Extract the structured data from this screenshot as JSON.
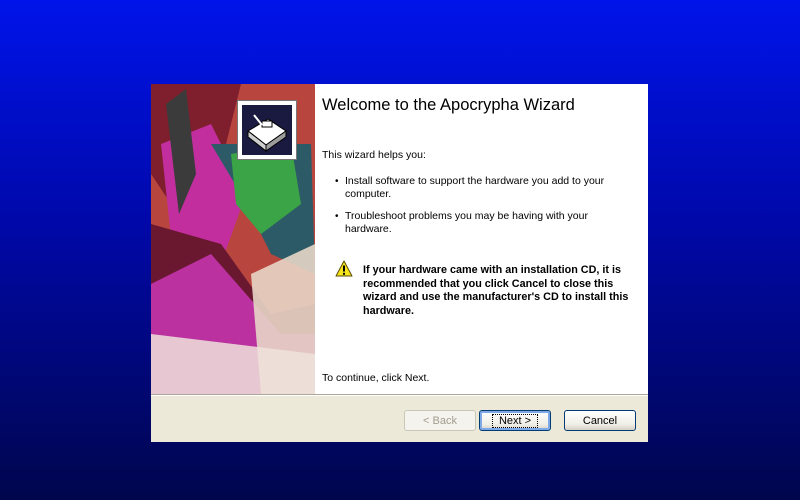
{
  "wizard": {
    "title": "Welcome to the Apocrypha Wizard",
    "intro": "This wizard helps you:",
    "bullets": [
      "Install software to support the hardware you add to your computer.",
      "Troubleshoot problems you may be having with your hardware."
    ],
    "warning": "If your hardware came with an installation CD, it is recommended that you click Cancel to close this wizard and use the manufacturer's CD to install this hardware.",
    "continue_text": "To continue, click Next.",
    "buttons": {
      "back": "< Back",
      "next": "Next >",
      "cancel": "Cancel"
    }
  },
  "icons": {
    "banner_logo": "hardware-device-icon",
    "warning": "warning-icon"
  },
  "colors": {
    "desktop_top": "#0014ea",
    "desktop_bottom": "#00064c",
    "dialog_face": "#ece9d8",
    "content_bg": "#ffffff"
  }
}
